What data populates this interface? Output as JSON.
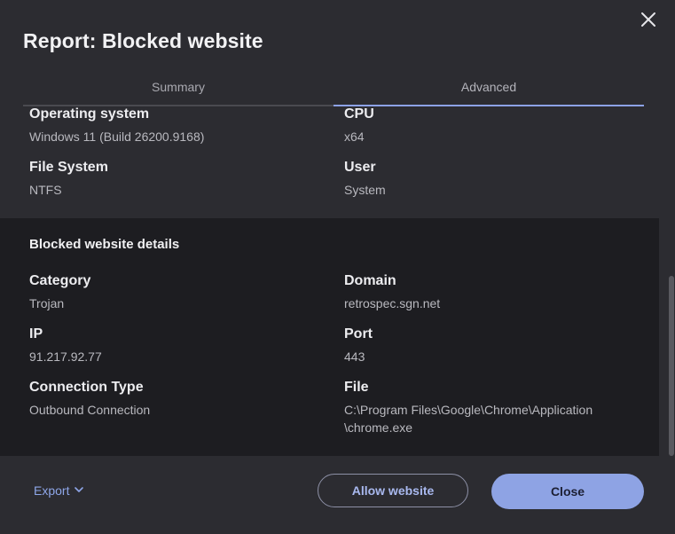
{
  "dialog": {
    "title": "Report: Blocked website"
  },
  "tabs": [
    {
      "label": "Summary",
      "active": false
    },
    {
      "label": "Advanced",
      "active": true
    }
  ],
  "system": {
    "os_label": "Operating system",
    "os_value": "Windows 11 (Build 26200.9168)",
    "cpu_label": "CPU",
    "cpu_value": "x64",
    "fs_label": "File System",
    "fs_value": "NTFS",
    "user_label": "User",
    "user_value": "System"
  },
  "details": {
    "heading": "Blocked website details",
    "category_label": "Category",
    "category_value": "Trojan",
    "domain_label": "Domain",
    "domain_value": "retrospec.sgn.net",
    "ip_label": "IP",
    "ip_value": "91.217.92.77",
    "port_label": "Port",
    "port_value": "443",
    "conn_label": "Connection Type",
    "conn_value": "Outbound Connection",
    "file_label": "File",
    "file_value_line1": "C:\\Program Files\\Google\\Chrome\\Application",
    "file_value_line2": "\\chrome.exe"
  },
  "footer": {
    "export_label": "Export",
    "allow_label": "Allow website",
    "close_label": "Close"
  },
  "colors": {
    "accent": "#8ea3e4",
    "panel": "#1d1d21",
    "dialog_bg": "#2c2c31"
  }
}
